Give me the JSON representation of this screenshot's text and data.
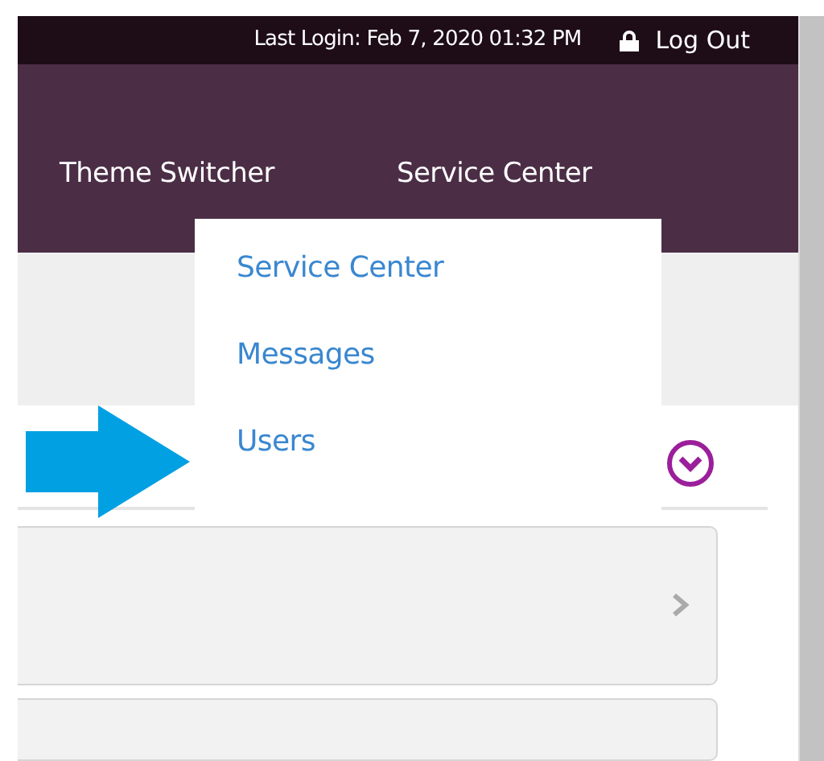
{
  "top_bar": {
    "last_login": "Last Login: Feb 7, 2020 01:32 PM",
    "logout": "Log Out"
  },
  "nav": [
    {
      "label": "Theme Switcher"
    },
    {
      "label": "Service Center"
    }
  ],
  "dropdown": [
    {
      "label": "Service Center"
    },
    {
      "label": "Messages"
    },
    {
      "label": "Users"
    }
  ]
}
